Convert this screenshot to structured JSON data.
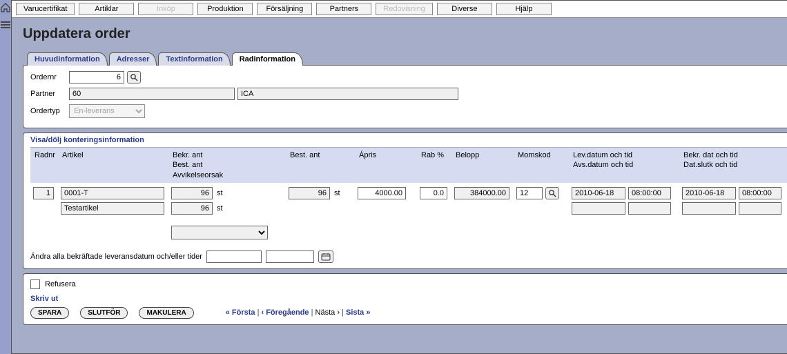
{
  "menu": {
    "items": [
      {
        "label": "Varucertifikat",
        "disabled": false
      },
      {
        "label": "Artiklar",
        "disabled": false
      },
      {
        "label": "Inköp",
        "disabled": true
      },
      {
        "label": "Produktion",
        "disabled": false
      },
      {
        "label": "Försäljning",
        "disabled": false
      },
      {
        "label": "Partners",
        "disabled": false
      },
      {
        "label": "Redovisning",
        "disabled": true
      },
      {
        "label": "Diverse",
        "disabled": false
      },
      {
        "label": "Hjälp",
        "disabled": false
      }
    ]
  },
  "page_title": "Uppdatera order",
  "tabs": [
    {
      "label": "Huvudinformation",
      "active": false
    },
    {
      "label": "Adresser",
      "active": false
    },
    {
      "label": "Textinformation",
      "active": false
    },
    {
      "label": "Radinformation",
      "active": true
    }
  ],
  "header": {
    "ordernr_label": "Ordernr",
    "ordernr_value": "6",
    "partner_label": "Partner",
    "partner_code": "60",
    "partner_name": "ICA",
    "ordertyp_label": "Ordertyp",
    "ordertyp_value": "En-leverans"
  },
  "kontering_link": "Visa/dölj konteringsinformation",
  "columns": {
    "radnr": "Radnr",
    "artikel": "Artikel",
    "bekr_block": "Bekr. ant\nBest. ant\nAvvikelseorsak",
    "best_ant": "Best. ant",
    "apris": "Ápris",
    "rab": "Rab %",
    "belopp": "Belopp",
    "momskod": "Momskod",
    "lev_block": "Lev.datum och tid\nAvs.datum och tid",
    "bekr_block2": "Bekr. dat och tid\nDat.slutk och tid"
  },
  "row": {
    "radnr": "1",
    "artikel_code": "0001-T",
    "artikel_name": "Testartikel",
    "bekr_ant": "96",
    "bekr_ant_unit": "st",
    "best_ant_local": "96",
    "best_ant_local_unit": "st",
    "avvikelse": "",
    "best_ant": "96",
    "best_ant_unit": "st",
    "apris": "4000.00",
    "rab": "0.0",
    "belopp": "384000.00",
    "momskod": "12",
    "lev_date": "2010-06-18",
    "lev_time": "08:00:00",
    "avs_date": "",
    "avs_time": "",
    "bekr_date": "2010-06-18",
    "bekr_time": "08:00:00",
    "slutk_date": "",
    "slutk_time": ""
  },
  "editline_label": "Ändra alla bekräftade leveransdatum och/eller tider",
  "refusera_label": "Refusera",
  "skriv_ut_label": "Skriv ut",
  "actions": {
    "spara": "SPARA",
    "slutfor": "SLUTFÖR",
    "makulera": "MAKULERA"
  },
  "pager": {
    "first": "« Första",
    "prev": "‹ Föregående",
    "next": "Nästa ›",
    "last": "Sista »",
    "sep": "|"
  }
}
